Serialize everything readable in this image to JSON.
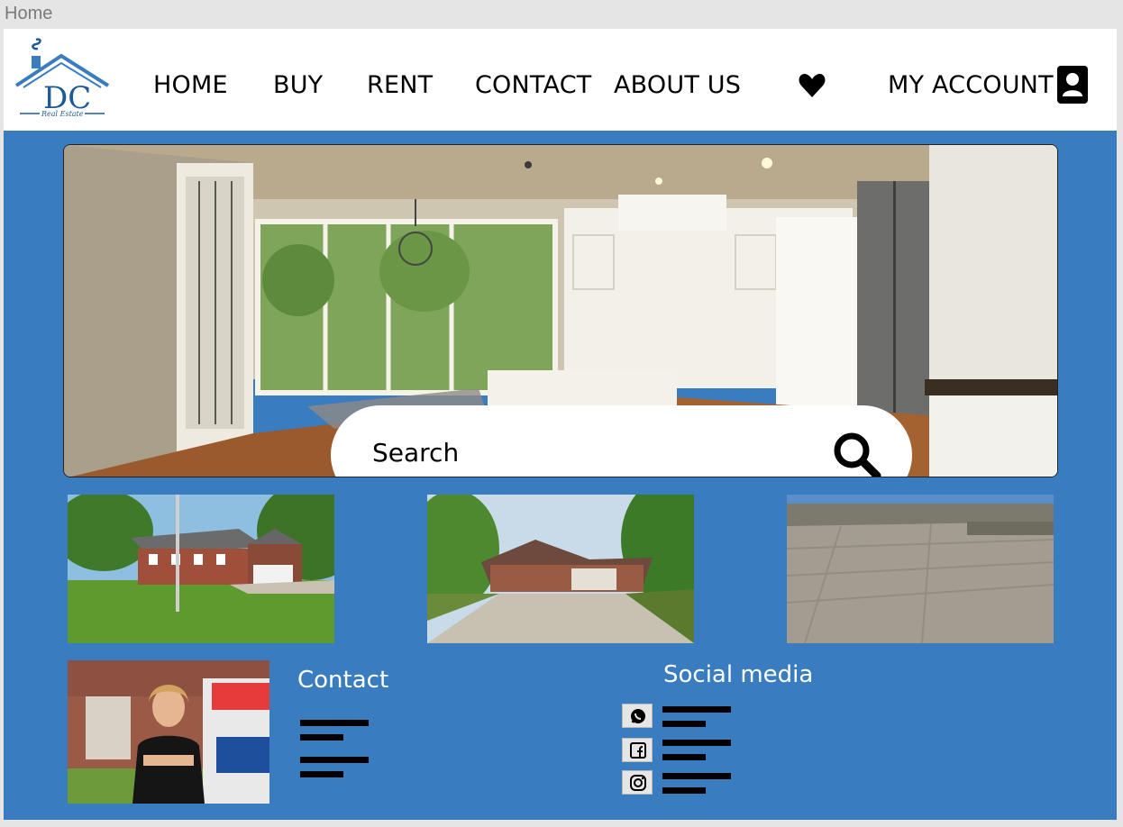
{
  "frame": {
    "label": "Home"
  },
  "header": {
    "logo": {
      "letters": "DC",
      "tagline": "Real Estate"
    },
    "nav": [
      {
        "label": "HOME"
      },
      {
        "label": "BUY"
      },
      {
        "label": "RENT"
      },
      {
        "label": "CONTACT"
      },
      {
        "label": "ABOUT US"
      }
    ],
    "favorites_icon": "heart-icon",
    "account": {
      "label": "MY ACCOUNT",
      "icon": "user-icon"
    }
  },
  "hero": {
    "search": {
      "placeholder": "Search",
      "icon": "search-icon"
    }
  },
  "listings": [
    {
      "image": "colonial-house-photo"
    },
    {
      "image": "ranch-house-photo"
    },
    {
      "image": "land-aerial-photo"
    }
  ],
  "contact": {
    "title": "Contact",
    "agent_photo": "agent-photo"
  },
  "social": {
    "title": "Social media",
    "items": [
      {
        "icon": "whatsapp-icon"
      },
      {
        "icon": "facebook-icon"
      },
      {
        "icon": "instagram-icon"
      }
    ]
  },
  "colors": {
    "page_background": "#3a7cc0",
    "header_background": "#ffffff",
    "text_dark": "#000000",
    "text_light": "#ffffff"
  }
}
